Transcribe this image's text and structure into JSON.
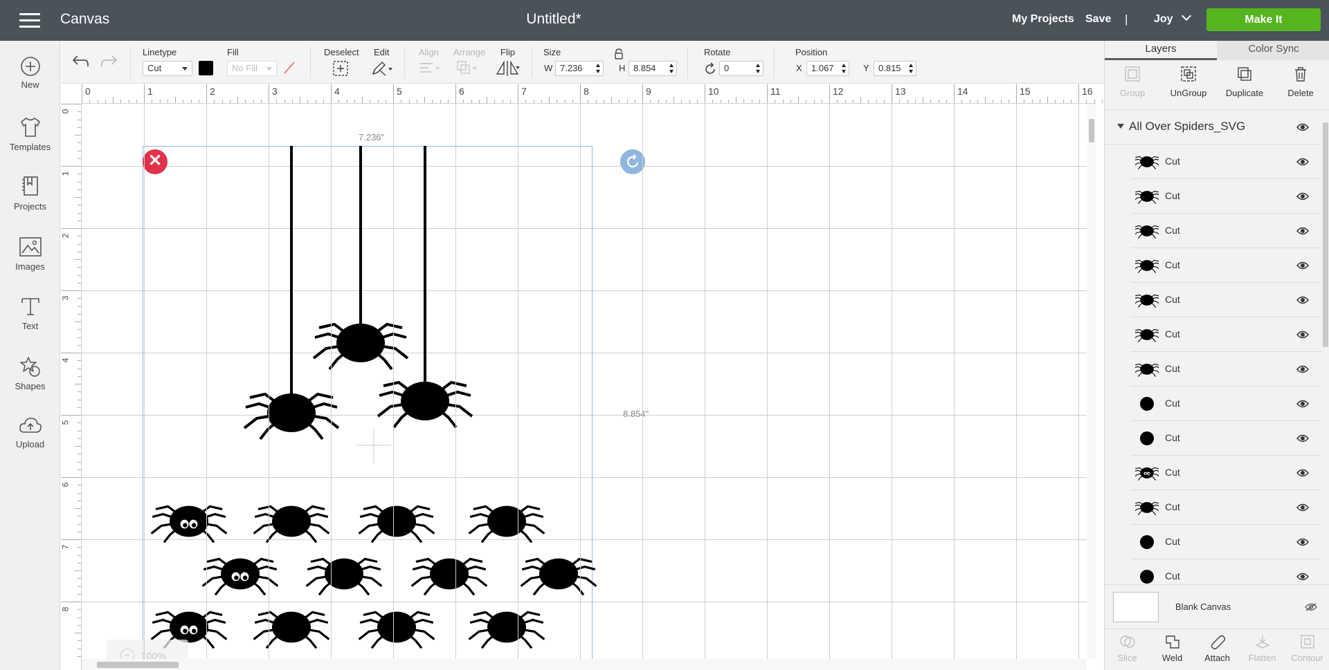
{
  "header": {
    "app_title": "Canvas",
    "doc_title": "Untitled*",
    "my_projects": "My Projects",
    "save": "Save",
    "separator": "|",
    "user": "Joy",
    "make_it": "Make It"
  },
  "sidebar": {
    "items": [
      {
        "label": "New",
        "icon": "plus-circle-icon"
      },
      {
        "label": "Templates",
        "icon": "tshirt-icon"
      },
      {
        "label": "Projects",
        "icon": "book-icon"
      },
      {
        "label": "Images",
        "icon": "image-icon"
      },
      {
        "label": "Text",
        "icon": "text-icon"
      },
      {
        "label": "Shapes",
        "icon": "shapes-icon"
      },
      {
        "label": "Upload",
        "icon": "cloud-upload-icon"
      }
    ]
  },
  "toolbar": {
    "linetype_label": "Linetype",
    "linetype_value": "Cut",
    "fill_label": "Fill",
    "fill_value": "No Fill",
    "deselect_label": "Deselect",
    "edit_label": "Edit",
    "align_label": "Align",
    "arrange_label": "Arrange",
    "flip_label": "Flip",
    "size_label": "Size",
    "width_letter": "W",
    "width_value": "7.236",
    "height_letter": "H",
    "height_value": "8.854",
    "rotate_label": "Rotate",
    "rotate_value": "0",
    "position_label": "Position",
    "x_letter": "X",
    "x_value": "1.067",
    "y_letter": "Y",
    "y_value": "0.815",
    "colors": {
      "linetype_swatch": "#000000"
    }
  },
  "canvas": {
    "ruler_top": [
      "0",
      "1",
      "2",
      "3",
      "4",
      "5",
      "6",
      "7",
      "8",
      "9",
      "10",
      "11",
      "12",
      "13",
      "14",
      "15",
      "16"
    ],
    "ruler_left": [
      "0",
      "1",
      "2",
      "3",
      "4",
      "5",
      "6",
      "7",
      "8"
    ],
    "width_label": "7.236\"",
    "height_label": "8.854\"",
    "delete_handle": "✕",
    "zoom_label": "100%"
  },
  "layers_panel": {
    "tab_layers": "Layers",
    "tab_color_sync": "Color Sync",
    "actions": [
      "Group",
      "UnGroup",
      "Duplicate",
      "Delete"
    ],
    "group_name": "All Over Spiders_SVG",
    "layers": [
      {
        "label": "Cut",
        "icon": "spider-icon"
      },
      {
        "label": "Cut",
        "icon": "spider-icon"
      },
      {
        "label": "Cut",
        "icon": "spider-icon"
      },
      {
        "label": "Cut",
        "icon": "spider-icon"
      },
      {
        "label": "Cut",
        "icon": "spider-icon"
      },
      {
        "label": "Cut",
        "icon": "spider-icon"
      },
      {
        "label": "Cut",
        "icon": "spider-icon"
      },
      {
        "label": "Cut",
        "icon": "dot-icon"
      },
      {
        "label": "Cut",
        "icon": "dot-icon"
      },
      {
        "label": "Cut",
        "icon": "spider-eyes-icon"
      },
      {
        "label": "Cut",
        "icon": "spider-icon"
      },
      {
        "label": "Cut",
        "icon": "dot-icon"
      },
      {
        "label": "Cut",
        "icon": "dot-icon"
      }
    ],
    "blank_canvas": "Blank Canvas",
    "bottom_actions": [
      "Slice",
      "Weld",
      "Attach",
      "Flatten",
      "Contour"
    ]
  }
}
